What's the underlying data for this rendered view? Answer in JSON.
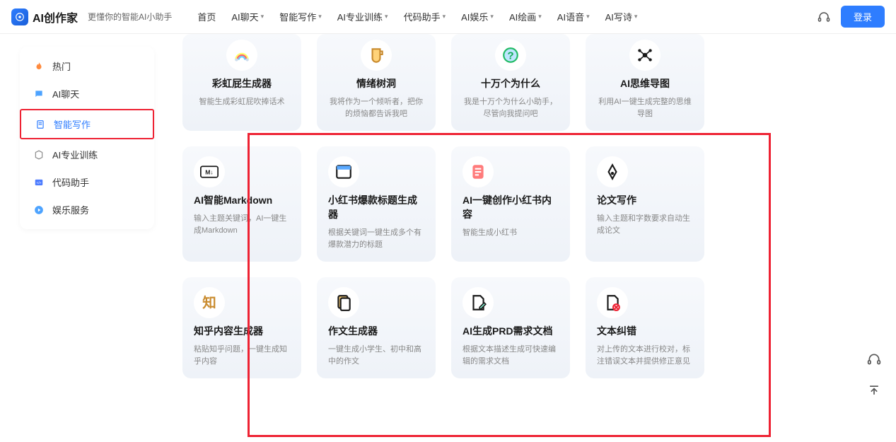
{
  "header": {
    "brand": "AI创作家",
    "subtitle": "更懂你的智能AI小助手",
    "nav": [
      {
        "label": "首页",
        "dropdown": false
      },
      {
        "label": "AI聊天",
        "dropdown": true
      },
      {
        "label": "智能写作",
        "dropdown": true
      },
      {
        "label": "AI专业训练",
        "dropdown": true
      },
      {
        "label": "代码助手",
        "dropdown": true
      },
      {
        "label": "AI娱乐",
        "dropdown": true
      },
      {
        "label": "AI绘画",
        "dropdown": true
      },
      {
        "label": "AI语音",
        "dropdown": true
      },
      {
        "label": "AI写诗",
        "dropdown": true
      }
    ],
    "login": "登录"
  },
  "sidebar": {
    "items": [
      {
        "label": "热门",
        "icon": "fire"
      },
      {
        "label": "AI聊天",
        "icon": "chat"
      },
      {
        "label": "智能写作",
        "icon": "doc",
        "active": true,
        "boxed": true
      },
      {
        "label": "AI专业训练",
        "icon": "cube"
      },
      {
        "label": "代码助手",
        "icon": "code"
      },
      {
        "label": "娱乐服务",
        "icon": "play"
      }
    ]
  },
  "top_cards": [
    {
      "title": "彩虹屁生成器",
      "desc": "智能生成彩虹屁吹捧话术"
    },
    {
      "title": "情绪树洞",
      "desc": "我将作为一个倾听者，把你的烦恼都告诉我吧"
    },
    {
      "title": "十万个为什么",
      "desc": "我是十万个为什么小助手，尽管向我提问吧"
    },
    {
      "title": "AI思维导图",
      "desc": "利用AI一键生成完整的思维导图"
    }
  ],
  "mid_cards": [
    {
      "title": "AI智能Markdown",
      "desc": "输入主题关键词，AI一键生成Markdown"
    },
    {
      "title": "小红书爆款标题生成器",
      "desc": "根据关键词一键生成多个有爆款潜力的标题"
    },
    {
      "title": "AI一键创作小红书内容",
      "desc": "智能生成小红书"
    },
    {
      "title": "论文写作",
      "desc": "输入主题和字数要求自动生成论文"
    }
  ],
  "bot_cards": [
    {
      "title": "知乎内容生成器",
      "desc": "粘贴知乎问题，一键生成知乎内容"
    },
    {
      "title": "作文生成器",
      "desc": "一键生成小学生、初中和高中的作文"
    },
    {
      "title": "AI生成PRD需求文档",
      "desc": "根据文本描述生成可快速编辑的需求文档"
    },
    {
      "title": "文本纠错",
      "desc": "对上传的文本进行校对，标注错误文本并提供修正意见"
    }
  ]
}
